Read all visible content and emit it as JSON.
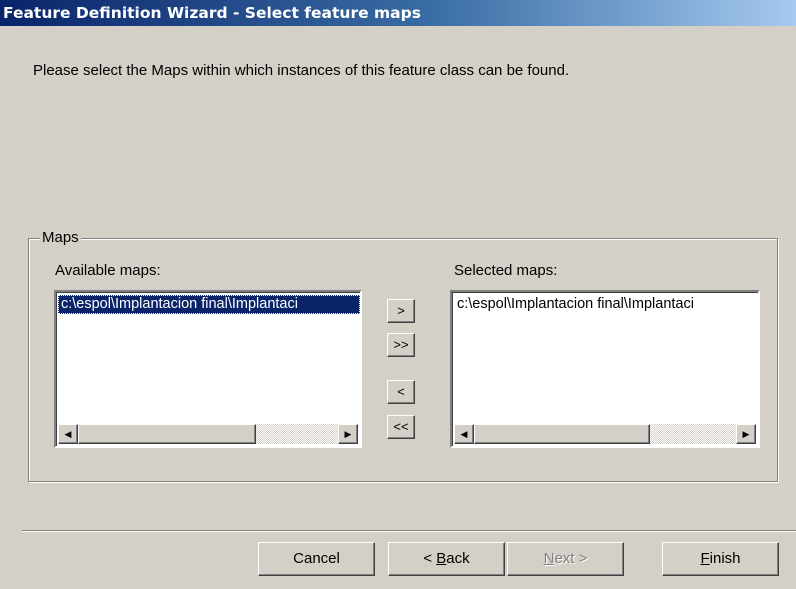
{
  "window": {
    "title": "Feature Definition Wizard - Select feature maps"
  },
  "instruction": "Please select the Maps within which instances of this feature class can be found.",
  "maps_group": {
    "label": "Maps",
    "available": {
      "label": "Available maps:",
      "items": [
        "c:\\espol\\Implantacion final\\Implantaci"
      ],
      "selected_index": 0
    },
    "selected": {
      "label": "Selected maps:",
      "items": [
        "c:\\espol\\Implantacion final\\Implantaci"
      ]
    },
    "transfer_buttons": {
      "add": ">",
      "add_all": ">>",
      "remove": "<",
      "remove_all": "<<"
    }
  },
  "footer": {
    "cancel": "Cancel",
    "back_prefix": "< ",
    "back_mnemonic": "B",
    "back_rest": "ack",
    "next_mnemonic": "N",
    "next_rest": "ext >",
    "finish_mnemonic": "F",
    "finish_rest": "inish",
    "next_enabled": false
  },
  "icons": {
    "scroll_left": "scroll-left-arrow-icon",
    "scroll_right": "scroll-right-arrow-icon"
  },
  "colors": {
    "dialog_bg": "#d4d0c8",
    "title_start": "#0a246a",
    "title_end": "#a6caf0",
    "selection": "#0a246a"
  }
}
